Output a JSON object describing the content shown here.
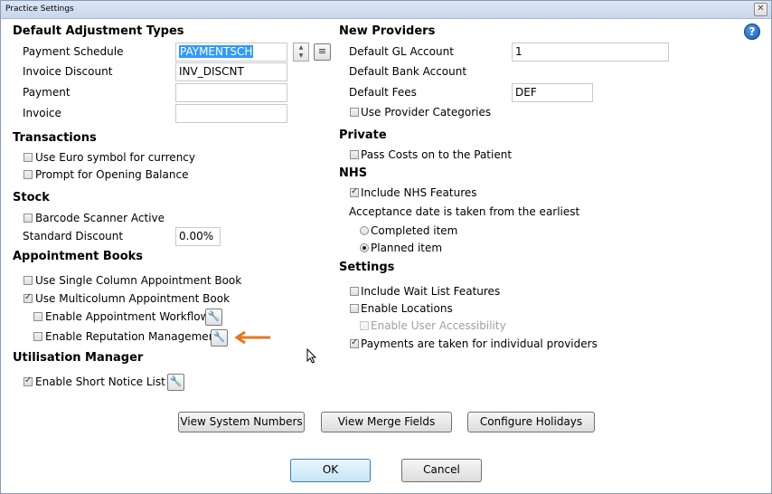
{
  "window": {
    "title": "Practice Settings",
    "close_glyph": "✕"
  },
  "help": {
    "icon": "help-icon",
    "glyph": "?"
  },
  "adjustment": {
    "header": "Default Adjustment Types",
    "payment_schedule": {
      "label": "Payment Schedule",
      "value": "PAYMENTSCH"
    },
    "invoice_discount": {
      "label": "Invoice Discount",
      "value": "INV_DISCNT"
    },
    "payment": {
      "label": "Payment",
      "value": ""
    },
    "invoice": {
      "label": "Invoice",
      "value": ""
    }
  },
  "transactions": {
    "header": "Transactions",
    "euro": {
      "label": "Use Euro symbol for currency",
      "checked": false
    },
    "opening_balance": {
      "label": "Prompt for Opening Balance",
      "checked": false
    }
  },
  "stock": {
    "header": "Stock",
    "barcode": {
      "label": "Barcode Scanner Active",
      "checked": false
    },
    "standard_discount": {
      "label": "Standard Discount",
      "value": "0.00%"
    }
  },
  "appointment_books": {
    "header": "Appointment Books",
    "single_column": {
      "label": "Use Single Column Appointment Book",
      "checked": false
    },
    "multicolumn": {
      "label": "Use Multicolumn Appointment Book",
      "checked": true
    },
    "workflow": {
      "label": "Enable Appointment Workflow",
      "checked": false
    },
    "reputation": {
      "label": "Enable Reputation Management",
      "checked": false
    }
  },
  "utilisation": {
    "header": "Utilisation Manager",
    "short_notice": {
      "label": "Enable Short Notice List",
      "checked": true
    }
  },
  "new_providers": {
    "header": "New Providers",
    "gl_account": {
      "label": "Default GL Account",
      "value": "1"
    },
    "bank_account": {
      "label": "Default Bank Account"
    },
    "fees": {
      "label": "Default Fees",
      "value": "DEF"
    },
    "categories": {
      "label": "Use Provider Categories",
      "checked": false
    }
  },
  "private": {
    "header": "Private",
    "pass_costs": {
      "label": "Pass Costs on to the Patient",
      "checked": false
    }
  },
  "nhs": {
    "header": "NHS",
    "include_features": {
      "label": "Include NHS Features",
      "checked": true
    },
    "acceptance_text": "Acceptance date is taken from the earliest",
    "completed": {
      "label": "Completed item",
      "selected": false
    },
    "planned": {
      "label": "Planned item",
      "selected": true
    }
  },
  "settings": {
    "header": "Settings",
    "wait_list": {
      "label": "Include Wait List Features",
      "checked": false
    },
    "locations": {
      "label": "Enable Locations",
      "checked": false
    },
    "user_accessibility": {
      "label": "Enable User Accessibility",
      "checked": false,
      "disabled": true
    },
    "individual_providers": {
      "label": "Payments are taken for individual providers",
      "checked": true
    }
  },
  "buttons": {
    "system_numbers": "View System Numbers",
    "merge_fields": "View Merge Fields",
    "holidays": "Configure Holidays",
    "ok": "OK",
    "cancel": "Cancel"
  },
  "colors": {
    "accent_arrow": "#e8761c",
    "selection": "#3399ff"
  }
}
